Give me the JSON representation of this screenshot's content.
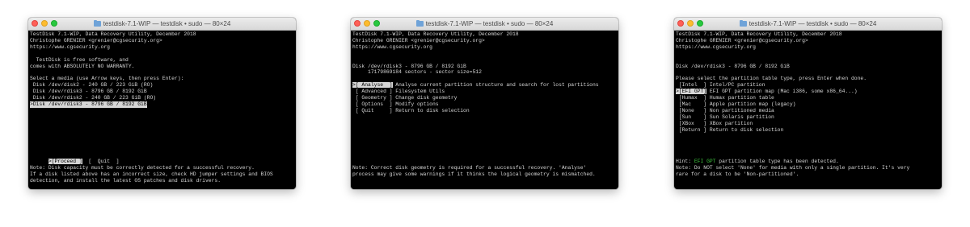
{
  "windows": [
    {
      "title": "testdisk-7.1-WIP — testdisk • sudo — 80×24",
      "header": [
        "TestDisk 7.1-WIP, Data Recovery Utility, December 2018",
        "Christophe GRENIER <grenier@cgsecurity.org>",
        "https://www.cgsecurity.org"
      ],
      "intro": [
        "  TestDisk is free software, and",
        "comes with ABSOLUTELY NO WARRANTY."
      ],
      "prompt": "Select a media (use Arrow keys, then press Enter):",
      "media": [
        {
          "label": " Disk /dev/disk2 - 240 GB / 223 GiB (RO)",
          "selected": false
        },
        {
          "label": " Disk /dev/rdisk3 - 8796 GB / 8192 GiB",
          "selected": false
        },
        {
          "label": " Disk /dev/rdisk2 - 240 GB / 223 GiB (RO)",
          "selected": false
        },
        {
          "label": ">Disk /dev/rdisk3 - 8796 GB / 8192 GiB",
          "selected": true
        }
      ],
      "proceed": ">[Proceed ]",
      "quit": "[  Quit  ]",
      "notes": [
        "Note: Disk capacity must be correctly detected for a successful recovery.",
        "If a disk listed above has an incorrect size, check HD jumper settings and BIOS",
        "detection, and install the latest OS patches and disk drivers."
      ]
    },
    {
      "title": "testdisk-7.1-WIP — testdisk • sudo — 80×24",
      "header": [
        "TestDisk 7.1-WIP, Data Recovery Utility, December 2018",
        "Christophe GRENIER <grenier@cgsecurity.org>",
        "https://www.cgsecurity.org"
      ],
      "disk": "Disk /dev/rdisk3 - 8796 GB / 8192 GiB",
      "sectors": "     17179869184 sectors - sector size=512",
      "menu": [
        {
          "key": ">[ Analyse  ]",
          "desc": " Analyse current partition structure and search for lost partitions",
          "selected": true
        },
        {
          "key": " [ Advanced ]",
          "desc": " Filesystem Utils",
          "selected": false
        },
        {
          "key": " [ Geometry ]",
          "desc": " Change disk geometry",
          "selected": false
        },
        {
          "key": " [ Options  ]",
          "desc": " Modify options",
          "selected": false
        },
        {
          "key": " [ Quit     ]",
          "desc": " Return to disk selection",
          "selected": false
        }
      ],
      "notes": [
        "Note: Correct disk geometry is required for a successful recovery. 'Analyse'",
        "process may give some warnings if it thinks the logical geometry is mismatched."
      ]
    },
    {
      "title": "testdisk-7.1-WIP — testdisk • sudo — 80×24",
      "header": [
        "TestDisk 7.1-WIP, Data Recovery Utility, December 2018",
        "Christophe GRENIER <grenier@cgsecurity.org>",
        "https://www.cgsecurity.org"
      ],
      "disk": "Disk /dev/rdisk3 - 8796 GB / 8192 GiB",
      "prompt": "Please select the partition table type, press Enter when done.",
      "types": [
        {
          "key": " [Intel  ]",
          "desc": " Intel/PC partition",
          "selected": false
        },
        {
          "key": ">[EFI GPT]",
          "desc": " EFI GPT partition map (Mac i386, some x86_64...)",
          "selected": true
        },
        {
          "key": " [Humax  ]",
          "desc": " Humax partition table",
          "selected": false
        },
        {
          "key": " [Mac    ]",
          "desc": " Apple partition map (legacy)",
          "selected": false
        },
        {
          "key": " [None   ]",
          "desc": " Non partitioned media",
          "selected": false
        },
        {
          "key": " [Sun    ]",
          "desc": " Sun Solaris partition",
          "selected": false
        },
        {
          "key": " [XBox   ]",
          "desc": " XBox partition",
          "selected": false
        },
        {
          "key": " [Return ]",
          "desc": " Return to disk selection",
          "selected": false
        }
      ],
      "hint_prefix": "Hint: ",
      "hint_highlight": "EFI GPT",
      "hint_suffix": " partition table type has been detected.",
      "notes": [
        "Note: Do NOT select 'None' for media with only a single partition. It's very",
        "rare for a disk to be 'Non-partitioned'."
      ]
    }
  ],
  "colors": {
    "terminal_bg": "#000000",
    "terminal_fg": "#d6d6d6",
    "selection_bg": "#d6d6d6",
    "hint_green": "#3ec43e"
  }
}
